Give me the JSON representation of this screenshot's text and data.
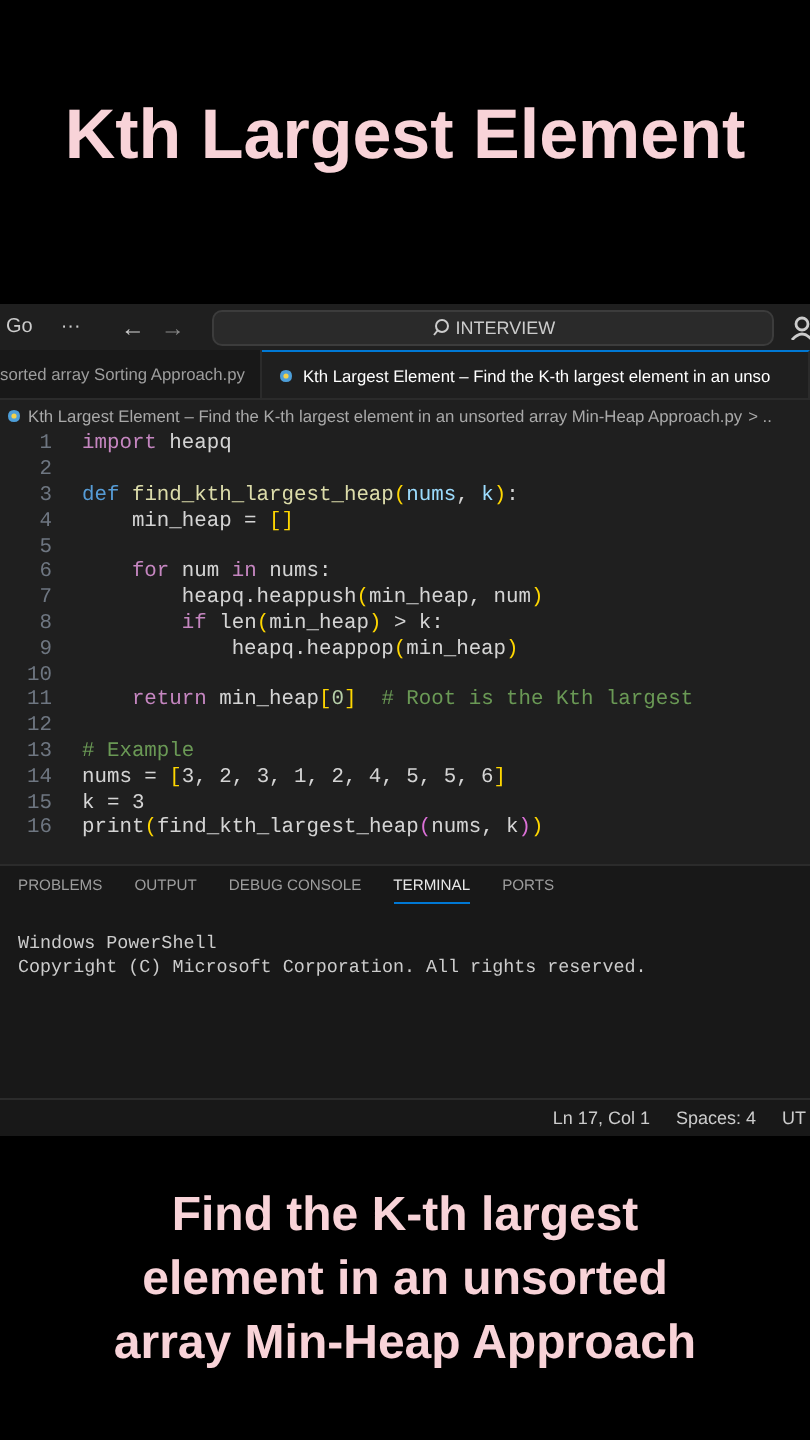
{
  "headline": "Kth Largest Element",
  "editor": {
    "title_bar": {
      "menu": "Go",
      "more": "···",
      "back": "←",
      "forward": "→",
      "search": "INTERVIEW"
    },
    "tabs": [
      {
        "label": "sorted array Sorting Approach.py",
        "selected": false
      },
      {
        "label": "Kth Largest Element – Find the K-th largest element in an unso",
        "selected": true
      }
    ],
    "breadcrumb": {
      "file": "Kth Largest Element – Find the K-th largest element in an unsorted array Min-Heap Approach.py",
      "more": "> .."
    },
    "code_lines": [
      {
        "number": "1",
        "tokens": [
          {
            "text": "import",
            "kind": "kw"
          },
          {
            "text": " heapq",
            "kind": "plain"
          }
        ]
      },
      {
        "number": "2"
      },
      {
        "number": "3",
        "tokens": [
          {
            "text": "def ",
            "kind": "def"
          },
          {
            "text": "find_kth_largest_heap",
            "kind": "fn"
          },
          {
            "text": "(",
            "kind": "br"
          },
          {
            "text": "nums",
            "kind": "var"
          },
          {
            "text": ", ",
            "kind": "plain"
          },
          {
            "text": "k",
            "kind": "var"
          },
          {
            "text": ")",
            "kind": "br"
          },
          {
            "text": ":",
            "kind": "plain"
          }
        ]
      },
      {
        "number": "4",
        "tokens": [
          {
            "text": "    min_heap = ",
            "kind": "plain"
          },
          {
            "text": "[]",
            "kind": "br"
          }
        ]
      },
      {
        "number": "5"
      },
      {
        "number": "6",
        "tokens": [
          {
            "text": "    for",
            "kind": "kw"
          },
          {
            "text": " num ",
            "kind": "plain"
          },
          {
            "text": "in",
            "kind": "kw"
          },
          {
            "text": " nums:",
            "kind": "plain"
          }
        ]
      },
      {
        "number": "7",
        "tokens": [
          {
            "text": "        heapq.heappush",
            "kind": "plain"
          },
          {
            "text": "(",
            "kind": "br"
          },
          {
            "text": "min_heap, num",
            "kind": "plain"
          },
          {
            "text": ")",
            "kind": "br"
          }
        ]
      },
      {
        "number": "8",
        "tokens": [
          {
            "text": "        if",
            "kind": "kw"
          },
          {
            "text": " len",
            "kind": "plain"
          },
          {
            "text": "(",
            "kind": "br"
          },
          {
            "text": "min_heap",
            "kind": "plain"
          },
          {
            "text": ")",
            "kind": "br"
          },
          {
            "text": " > k:",
            "kind": "plain"
          }
        ]
      },
      {
        "number": "9",
        "tokens": [
          {
            "text": "            heapq.heappop",
            "kind": "plain"
          },
          {
            "text": "(",
            "kind": "br"
          },
          {
            "text": "min_heap",
            "kind": "plain"
          },
          {
            "text": ")",
            "kind": "br"
          }
        ]
      },
      {
        "number": "10"
      },
      {
        "number": "11",
        "tokens": [
          {
            "text": "    return",
            "kind": "kw"
          },
          {
            "text": " min_heap",
            "kind": "plain"
          },
          {
            "text": "[",
            "kind": "br"
          },
          {
            "text": "0",
            "kind": "num"
          },
          {
            "text": "]",
            "kind": "br"
          },
          {
            "text": "  # Root is the Kth largest",
            "kind": "cmt"
          }
        ]
      },
      {
        "number": "12"
      },
      {
        "number": "13",
        "tokens": [
          {
            "text": "# Example",
            "kind": "cmt"
          }
        ]
      },
      {
        "number": "14",
        "tokens": [
          {
            "text": "nums = ",
            "kind": "plain"
          },
          {
            "text": "[",
            "kind": "br"
          },
          {
            "text": "3, 2, 3, 1, 2, 4, 5, 5, 6",
            "kind": "plain"
          },
          {
            "text": "]",
            "kind": "br"
          }
        ]
      },
      {
        "number": "15",
        "tokens": [
          {
            "text": "k = 3",
            "kind": "plain"
          }
        ]
      },
      {
        "number": "16",
        "tokens": [
          {
            "text": "print",
            "kind": "plain"
          },
          {
            "text": "(",
            "kind": "br"
          },
          {
            "text": "find_kth_largest_heap",
            "kind": "plain"
          },
          {
            "text": "(",
            "kind": "br2"
          },
          {
            "text": "nums, k",
            "kind": "plain"
          },
          {
            "text": ")",
            "kind": "br2"
          },
          {
            "text": ")",
            "kind": "br"
          }
        ]
      }
    ],
    "panel_tabs": [
      {
        "label": "PROBLEMS",
        "selected": false
      },
      {
        "label": "OUTPUT",
        "selected": false
      },
      {
        "label": "DEBUG CONSOLE",
        "selected": false
      },
      {
        "label": "TERMINAL",
        "selected": true
      },
      {
        "label": "PORTS",
        "selected": false
      }
    ],
    "terminal_lines": [
      "Windows PowerShell",
      "Copyright (C) Microsoft Corporation. All rights reserved."
    ],
    "status_bar": [
      "Ln 17, Col 1",
      "Spaces: 4",
      "UT"
    ]
  },
  "caption": "Find the K-th largest element in an unsorted array Min-Heap Approach"
}
